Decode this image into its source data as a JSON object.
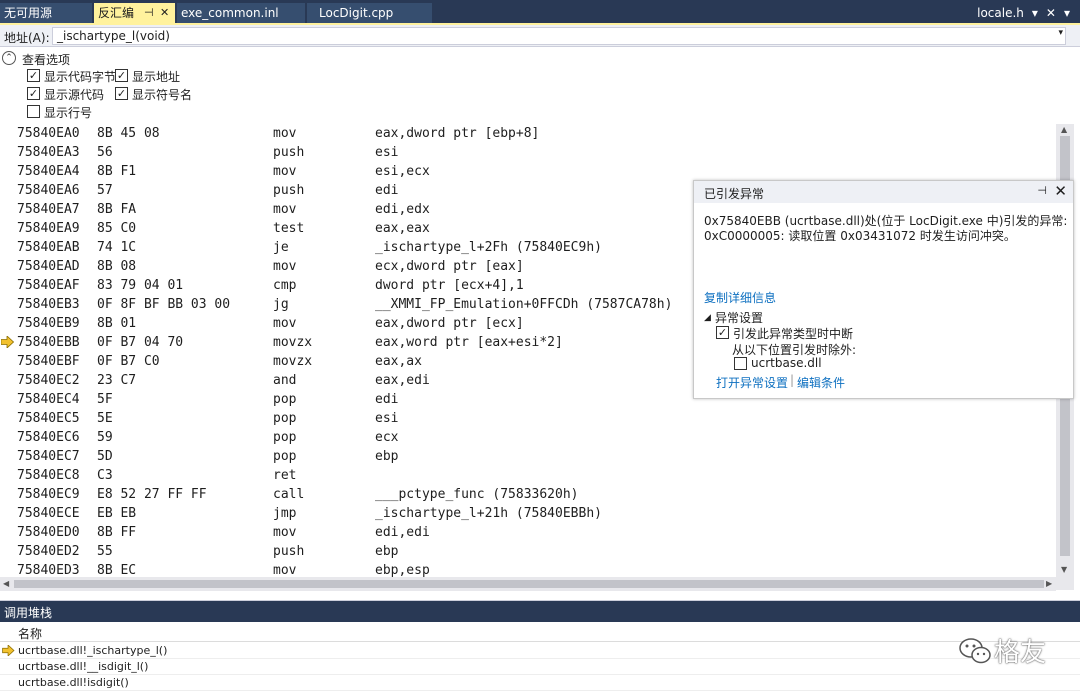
{
  "tabs": [
    {
      "label": "无可用源"
    },
    {
      "label": "反汇编"
    },
    {
      "label": "exe_common.inl"
    },
    {
      "label": "LocDigit.cpp"
    }
  ],
  "tab_right": {
    "label": "locale.h",
    "dropdown": "▾",
    "close": "✕",
    "menu": "▾"
  },
  "tab_glyphs": {
    "pin": "⊣",
    "close": "✕"
  },
  "address": {
    "label": "地址(A):",
    "value": "_ischartype_l(void)",
    "dropdown": "▾"
  },
  "view_options": {
    "title": "查看选项",
    "collapse": "⌃",
    "items": [
      {
        "label": "显示代码字节",
        "checked": "✓"
      },
      {
        "label": "显示地址",
        "checked": "✓"
      },
      {
        "label": "显示源代码",
        "checked": "✓"
      },
      {
        "label": "显示符号名",
        "checked": "✓"
      },
      {
        "label": "显示行号",
        "checked": ""
      }
    ]
  },
  "code": [
    {
      "addr": "75840EA0",
      "bytes": "8B 45 08",
      "mnemonic": "mov",
      "operands": "eax,dword ptr [ebp+8]"
    },
    {
      "addr": "75840EA3",
      "bytes": "56",
      "mnemonic": "push",
      "operands": "esi"
    },
    {
      "addr": "75840EA4",
      "bytes": "8B F1",
      "mnemonic": "mov",
      "operands": "esi,ecx"
    },
    {
      "addr": "75840EA6",
      "bytes": "57",
      "mnemonic": "push",
      "operands": "edi"
    },
    {
      "addr": "75840EA7",
      "bytes": "8B FA",
      "mnemonic": "mov",
      "operands": "edi,edx"
    },
    {
      "addr": "75840EA9",
      "bytes": "85 C0",
      "mnemonic": "test",
      "operands": "eax,eax"
    },
    {
      "addr": "75840EAB",
      "bytes": "74 1C",
      "mnemonic": "je",
      "operands": "_ischartype_l+2Fh (75840EC9h)"
    },
    {
      "addr": "75840EAD",
      "bytes": "8B 08",
      "mnemonic": "mov",
      "operands": "ecx,dword ptr [eax]"
    },
    {
      "addr": "75840EAF",
      "bytes": "83 79 04 01",
      "mnemonic": "cmp",
      "operands": "dword ptr [ecx+4],1"
    },
    {
      "addr": "75840EB3",
      "bytes": "0F 8F BF BB 03 00",
      "mnemonic": "jg",
      "operands": "__XMMI_FP_Emulation+0FFCDh (7587CA78h)"
    },
    {
      "addr": "75840EB9",
      "bytes": "8B 01",
      "mnemonic": "mov",
      "operands": "eax,dword ptr [ecx]"
    },
    {
      "addr": "75840EBB",
      "bytes": "0F B7 04 70",
      "mnemonic": "movzx",
      "operands": "eax,word ptr [eax+esi*2]"
    },
    {
      "addr": "75840EBF",
      "bytes": "0F B7 C0",
      "mnemonic": "movzx",
      "operands": "eax,ax"
    },
    {
      "addr": "75840EC2",
      "bytes": "23 C7",
      "mnemonic": "and",
      "operands": "eax,edi"
    },
    {
      "addr": "75840EC4",
      "bytes": "5F",
      "mnemonic": "pop",
      "operands": "edi"
    },
    {
      "addr": "75840EC5",
      "bytes": "5E",
      "mnemonic": "pop",
      "operands": "esi"
    },
    {
      "addr": "75840EC6",
      "bytes": "59",
      "mnemonic": "pop",
      "operands": "ecx"
    },
    {
      "addr": "75840EC7",
      "bytes": "5D",
      "mnemonic": "pop",
      "operands": "ebp"
    },
    {
      "addr": "75840EC8",
      "bytes": "C3",
      "mnemonic": "ret",
      "operands": ""
    },
    {
      "addr": "75840EC9",
      "bytes": "E8 52 27 FF FF",
      "mnemonic": "call",
      "operands": "___pctype_func (75833620h)"
    },
    {
      "addr": "75840ECE",
      "bytes": "EB EB",
      "mnemonic": "jmp",
      "operands": "_ischartype_l+21h (75840EBBh)"
    },
    {
      "addr": "75840ED0",
      "bytes": "8B FF",
      "mnemonic": "mov",
      "operands": "edi,edi"
    },
    {
      "addr": "75840ED2",
      "bytes": "55",
      "mnemonic": "push",
      "operands": "ebp"
    },
    {
      "addr": "75840ED3",
      "bytes": "8B EC",
      "mnemonic": "mov",
      "operands": "ebp,esp"
    }
  ],
  "current_instruction_row": 11,
  "exception": {
    "title": "已引发异常",
    "pin": "⊣",
    "close": "✕",
    "message_line1": "0x75840EBB (ucrtbase.dll)处(位于 LocDigit.exe 中)引发的异常:",
    "message_line2": "0xC0000005: 读取位置 0x03431072 时发生访问冲突。",
    "copy_details": "复制详细信息",
    "settings_title": "异常设置",
    "settings_tri": "◢",
    "break_option": "引发此异常类型时中断",
    "break_checked": "✓",
    "except_from": "从以下位置引发时除外:",
    "except_item": "ucrtbase.dll",
    "except_checked": "",
    "open_settings": "打开异常设置",
    "edit_conditions": "编辑条件",
    "separator": "|"
  },
  "callstack": {
    "title": "调用堆栈",
    "column": "名称",
    "rows": [
      {
        "name": "ucrtbase.dll!_ischartype_l()"
      },
      {
        "name": "ucrtbase.dll!__isdigit_l()"
      },
      {
        "name": "ucrtbase.dll!isdigit()"
      }
    ]
  },
  "scroll_glyphs": {
    "up": "▲",
    "down": "▼",
    "left": "◀",
    "right": "▶"
  },
  "watermark": {
    "text": "格友"
  },
  "colors": {
    "tab_bar": "#293955",
    "active_tab": "#fff29d",
    "link": "#0e70c0",
    "arrow": "#f2c12e"
  }
}
